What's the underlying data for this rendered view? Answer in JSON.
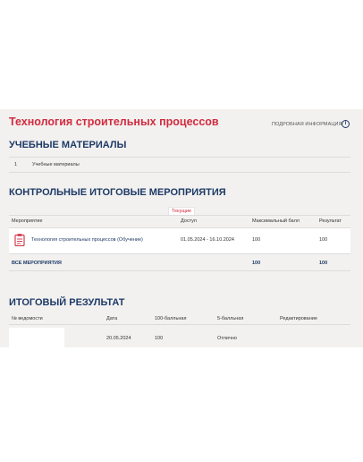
{
  "title": "Технология строительных процессов",
  "info_link": "ПОДРОБНАЯ ИНФОРМАЦИЯ",
  "info_icon": "i",
  "materials": {
    "heading": "УЧЕБНЫЕ МАТЕРИАЛЫ",
    "items": [
      {
        "num": "1",
        "label": "Учебные материалы"
      }
    ]
  },
  "control": {
    "heading": "КОНТРОЛЬНЫЕ ИТОГОВЫЕ МЕРОПРИЯТИЯ",
    "current_tag": "Текущие",
    "columns": [
      "Мероприятие",
      "Доступ",
      "Максимальный балл",
      "Результат"
    ],
    "row": {
      "name": "Технология строительных процессов (Обучение)",
      "access": "01.05.2024 - 16.10.2024",
      "max": "100",
      "result": "100"
    },
    "total": {
      "label": "ВСЕ МЕРОПРИЯТИЯ",
      "max": "100",
      "result": "100"
    }
  },
  "final": {
    "heading": "ИТОГОВЫЙ РЕЗУЛЬТАТ",
    "columns": [
      "№ ведомости",
      "Дата",
      "100-балльная",
      "5-балльная",
      "Редактирование"
    ],
    "row": {
      "date": "20.05.2024",
      "score100": "100",
      "score5": "Отлично"
    }
  },
  "colors": {
    "accent_red": "#d22b3f",
    "heading_blue": "#1e3a66",
    "panel_bg": "#f2f1f0"
  }
}
